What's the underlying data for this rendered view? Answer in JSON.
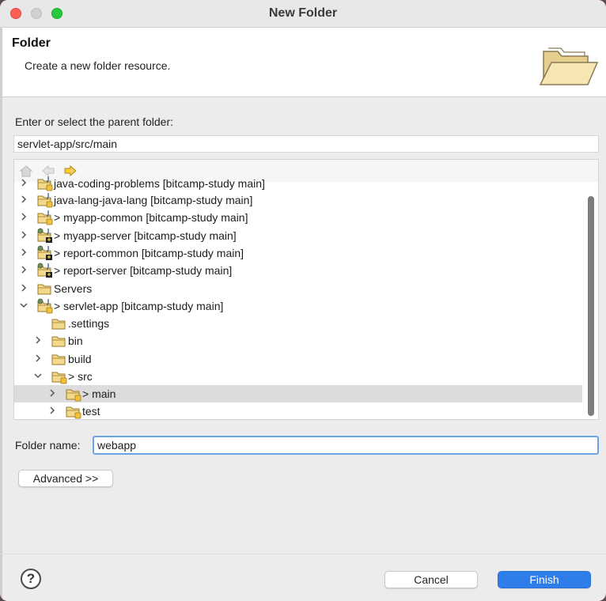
{
  "window": {
    "title": "New Folder"
  },
  "banner": {
    "title": "Folder",
    "description": "Create a new folder resource."
  },
  "parent": {
    "label": "Enter or select the parent folder:",
    "value": "servlet-app/src/main"
  },
  "tree": {
    "items": [
      {
        "label": "java-coding-problems [bitcamp-study main]",
        "type": "project-java"
      },
      {
        "label": "java-lang-java-lang [bitcamp-study main]",
        "type": "project-java"
      },
      {
        "label": "> myapp-common [bitcamp-study main]",
        "type": "project-java"
      },
      {
        "label": "> myapp-server [bitcamp-study main]",
        "type": "project-server"
      },
      {
        "label": "> report-common [bitcamp-study main]",
        "type": "project-server"
      },
      {
        "label": "> report-server [bitcamp-study main]",
        "type": "project-server"
      },
      {
        "label": "Servers",
        "type": "folder"
      },
      {
        "label": "> servlet-app [bitcamp-study main]",
        "type": "project-web"
      },
      {
        "label": ".settings",
        "type": "folder"
      },
      {
        "label": "bin",
        "type": "folder"
      },
      {
        "label": "build",
        "type": "folder"
      },
      {
        "label": "> src",
        "type": "folder-git"
      },
      {
        "label": "> main",
        "type": "folder-git"
      },
      {
        "label": "test",
        "type": "folder-git"
      }
    ]
  },
  "folder_name": {
    "label": "Folder name:",
    "value": "webapp"
  },
  "buttons": {
    "advanced": "Advanced >>",
    "cancel": "Cancel",
    "finish": "Finish",
    "help": "?"
  },
  "colors": {
    "accent": "#2f7de8",
    "selection": "#dcdcdc"
  }
}
